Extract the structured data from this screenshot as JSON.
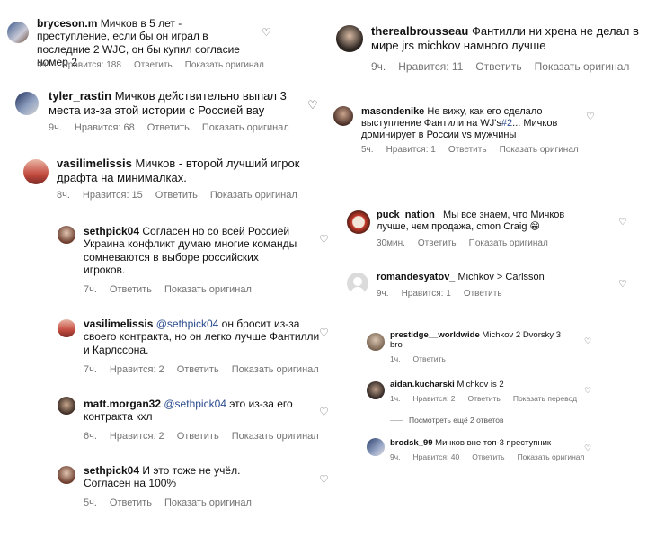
{
  "labels": {
    "reply": "Ответить",
    "translate_original": "Показать оригинал",
    "translate": "Показать перевод"
  },
  "icons": {
    "like": "heart-outline-icon"
  },
  "left": [
    {
      "user": "bryceson.m",
      "text": "Мичков в 5 лет - преступление, если бы он играл в последние 2 WJC, он бы купил согласие номер 2",
      "time": "9ч.",
      "likes": "Нравится: 188"
    },
    {
      "user": "tyler_rastin",
      "text": "Мичков действительно выпал 3 места из-за этой истории с Россией вау",
      "time": "9ч.",
      "likes": "Нравится: 68"
    },
    {
      "user": "vasilimelissis",
      "text": "Мичков - второй лучший игрок драфта на минималках.",
      "time": "8ч.",
      "likes": "Нравится: 15"
    },
    {
      "user": "sethpick04",
      "text": "Согласен но со всей Россией Украина конфликт думаю многие команды сомневаются в выборе российских игроков.",
      "time": "7ч."
    },
    {
      "user": "vasilimelissis",
      "mention": "@sethpick04",
      "text": "он бросит из-за своего контракта, но он легко лучше Фантилли и Карлссона.",
      "time": "7ч.",
      "likes": "Нравится: 2"
    },
    {
      "user": "matt.morgan32",
      "mention": "@sethpick04",
      "text": "это из-за его контракта кхл",
      "time": "6ч.",
      "likes": "Нравится: 2"
    },
    {
      "user": "sethpick04",
      "text": "И это тоже не учёл. Согласен на 100%",
      "time": "5ч."
    }
  ],
  "right": [
    {
      "user": "therealbrousseau",
      "text": "Фантилли ни хрена не делал в мире jrs michkov намного лучше",
      "time": "9ч.",
      "likes": "Нравится: 11"
    },
    {
      "user": "masondenike",
      "text": "Не вижу, как его сделало выступление Фантили на WJ's",
      "hashtag": "#2",
      "text2": "... Мичков доминирует в России vs мужчины",
      "time": "5ч.",
      "likes": "Нравится: 1"
    },
    {
      "user": "puck_nation_",
      "text": "Мы все знаем, что Мичков лучше, чем продажа, cmon Craig 😁",
      "time": "30мин."
    },
    {
      "user": "romandesyatov_",
      "text": "Michkov > Carlsson",
      "time": "9ч.",
      "likes": "Нравится: 1"
    },
    {
      "user": "prestidge__worldwide",
      "text": "Michkov 2 Dvorsky 3 bro",
      "time": "1ч."
    },
    {
      "user": "aidan.kucharski",
      "text": "Michkov is 2",
      "time": "1ч.",
      "likes": "Нравится: 2"
    },
    {
      "view_replies": "Посмотреть ещё 2 ответов"
    },
    {
      "user": "brodsk_99",
      "text": "Мичков вне топ-3 преступник",
      "time": "9ч.",
      "likes": "Нравится: 40"
    }
  ]
}
